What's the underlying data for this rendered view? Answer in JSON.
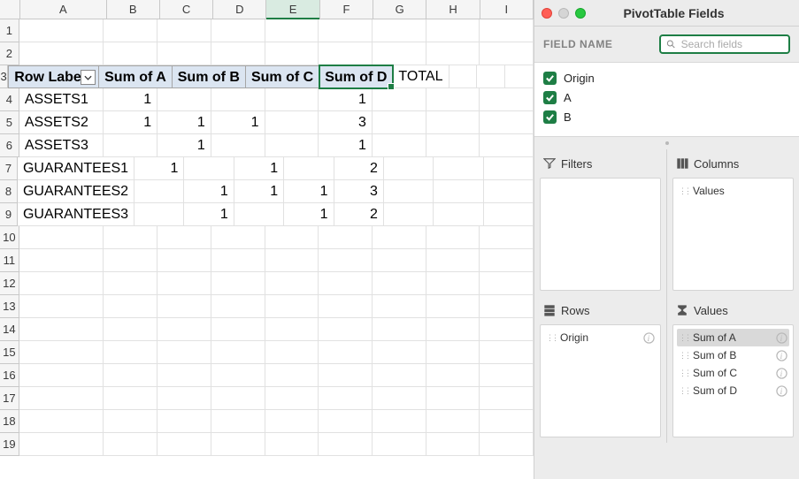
{
  "columns": [
    "A",
    "B",
    "C",
    "D",
    "E",
    "F",
    "G",
    "H",
    "I"
  ],
  "rowNumbers": [
    "1",
    "2",
    "3",
    "4",
    "5",
    "6",
    "7",
    "8",
    "9",
    "10",
    "11",
    "12",
    "13",
    "14",
    "15",
    "16",
    "17",
    "18",
    "19"
  ],
  "selectedColumn": "E",
  "selectedCell": {
    "row": 3,
    "col": "E"
  },
  "pivot": {
    "headers": {
      "rowLabels": "Row Labels",
      "sumA": "Sum of A",
      "sumB": "Sum of B",
      "sumC": "Sum of C",
      "sumD": "Sum of D",
      "total": "TOTAL"
    },
    "rows": [
      {
        "label": "ASSETS1",
        "A": "1",
        "B": "",
        "C": "",
        "D": "",
        "total": "1"
      },
      {
        "label": "ASSETS2",
        "A": "1",
        "B": "1",
        "C": "1",
        "D": "",
        "total": "3"
      },
      {
        "label": "ASSETS3",
        "A": "",
        "B": "1",
        "C": "",
        "D": "",
        "total": "1"
      },
      {
        "label": "GUARANTEES1",
        "A": "1",
        "B": "",
        "C": "1",
        "D": "",
        "total": "2"
      },
      {
        "label": "GUARANTEES2",
        "A": "",
        "B": "1",
        "C": "1",
        "D": "1",
        "total": "3"
      },
      {
        "label": "GUARANTEES3",
        "A": "",
        "B": "1",
        "C": "",
        "D": "1",
        "total": "2"
      }
    ]
  },
  "panel": {
    "title": "PivotTable Fields",
    "fieldNameLabel": "FIELD NAME",
    "searchPlaceholder": "Search fields",
    "fields": [
      {
        "name": "Origin",
        "checked": true
      },
      {
        "name": "A",
        "checked": true
      },
      {
        "name": "B",
        "checked": true
      }
    ],
    "zones": {
      "filters": "Filters",
      "columns": "Columns",
      "rows": "Rows",
      "values": "Values"
    },
    "filtersItems": [],
    "columnsItems": [
      "Values"
    ],
    "rowsItems": [
      "Origin"
    ],
    "valuesItems": [
      "Sum of A",
      "Sum of B",
      "Sum of C",
      "Sum of D"
    ]
  }
}
